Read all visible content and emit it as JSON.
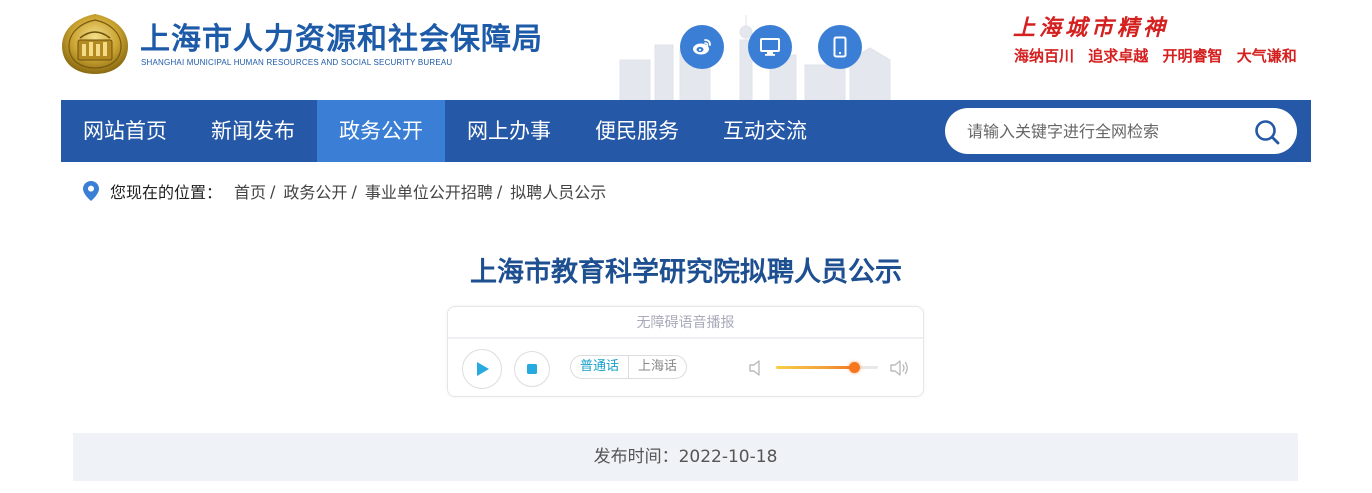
{
  "header": {
    "logo_cn": "上海市人力资源和社会保障局",
    "logo_en": "SHANGHAI MUNICIPAL HUMAN RESOURCES AND SOCIAL SECURITY BUREAU",
    "social_icons": [
      "weibo-icon",
      "desktop-icon",
      "mobile-icon"
    ],
    "spirit_title": "上海城市精神",
    "spirit_words": [
      "海纳百川",
      "追求卓越",
      "开明睿智",
      "大气谦和"
    ]
  },
  "nav": {
    "items": [
      {
        "label": "网站首页",
        "active": false
      },
      {
        "label": "新闻发布",
        "active": false
      },
      {
        "label": "政务公开",
        "active": true
      },
      {
        "label": "网上办事",
        "active": false
      },
      {
        "label": "便民服务",
        "active": false
      },
      {
        "label": "互动交流",
        "active": false
      }
    ],
    "search_placeholder": "请输入关键字进行全网检索",
    "search_value": ""
  },
  "breadcrumb": {
    "label": "您现在的位置：",
    "items": [
      "首页",
      "政务公开",
      "事业单位公开招聘",
      "拟聘人员公示"
    ],
    "separator": "/"
  },
  "article": {
    "title": "上海市教育科学研究院拟聘人员公示",
    "publish": "发布时间：2022-10-18"
  },
  "player": {
    "title": "无障碍语音播报",
    "languages": [
      {
        "label": "普通话",
        "active": true
      },
      {
        "label": "上海话",
        "active": false
      }
    ],
    "volume": 0.76
  },
  "colors": {
    "nav_bg": "#2558a6",
    "nav_active": "#3a7fd5",
    "title": "#1d4f91",
    "spirit": "#d4201f"
  }
}
